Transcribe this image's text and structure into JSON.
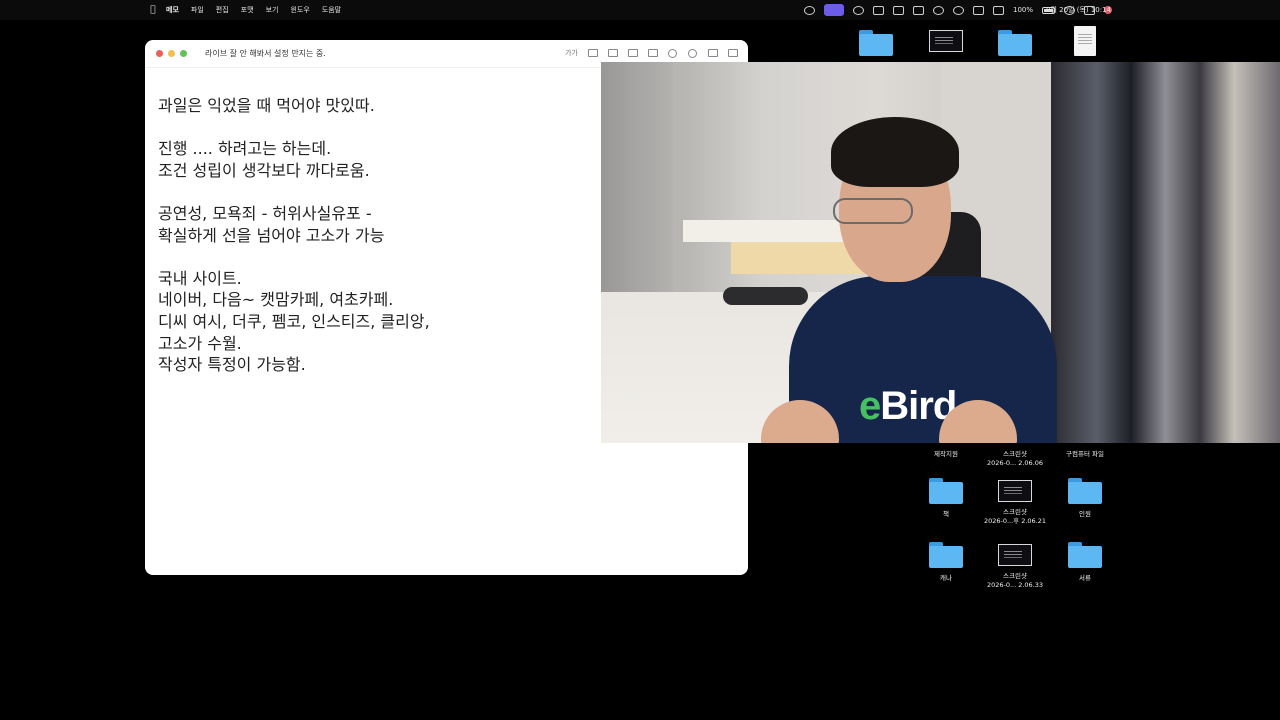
{
  "menubar": {
    "apple_icon": "apple-icon",
    "items": [
      "메모",
      "파일",
      "편집",
      "포맷",
      "보기",
      "윈도우",
      "도움말"
    ],
    "battery_percent": "100%",
    "datetime": "8월 20일 (목) 10:14"
  },
  "notes_window": {
    "title": "라이브 잘 안 해봐서 설정 만지는 중.",
    "toolbar": {
      "font_button": "가가"
    },
    "lines": [
      "과일은 익었을 때 먹어야 맛있따.",
      "",
      "진행 .... 하려고는 하는데.",
      "조건 성립이 생각보다 까다로움.",
      "",
      "공연성, 모욕죄 - 허위사실유포 -",
      "확실하게 선을 넘어야 고소가 가능",
      "",
      "국내 사이트.",
      "네이버, 다음~   캣맘카페, 여초카페.",
      "디씨 여시, 더쿠, 펨코, 인스티즈, 클리앙,",
      "고소가 수월.",
      "작성자 특정이 가능함."
    ]
  },
  "webcam": {
    "shirt_logo_accent": "e",
    "shirt_logo_rest": "Bird"
  },
  "desktop": {
    "items": [
      {
        "kind": "folder",
        "label_1": "제작지원",
        "label_2": ""
      },
      {
        "kind": "screenshot",
        "label_1": "스크린샷",
        "label_2": "2026-0... 2.06.06"
      },
      {
        "kind": "folder",
        "label_1": "구컴퓨터 파일",
        "label_2": ""
      },
      {
        "kind": "folder",
        "label_1": "책",
        "label_2": ""
      },
      {
        "kind": "screenshot",
        "label_1": "스크린샷",
        "label_2": "2026-0...후 2.06.21"
      },
      {
        "kind": "folder",
        "label_1": "인원",
        "label_2": ""
      },
      {
        "kind": "folder",
        "label_1": "캐나",
        "label_2": ""
      },
      {
        "kind": "screenshot",
        "label_1": "스크린샷",
        "label_2": "2026-0... 2.06.33"
      },
      {
        "kind": "folder",
        "label_1": "서류",
        "label_2": ""
      }
    ]
  },
  "colors": {
    "folder": "#5db7f3",
    "traffic_red": "#ee5e56",
    "traffic_yellow": "#f4bf4f",
    "traffic_green": "#5fc454",
    "active_status": "#6d5ce8"
  }
}
